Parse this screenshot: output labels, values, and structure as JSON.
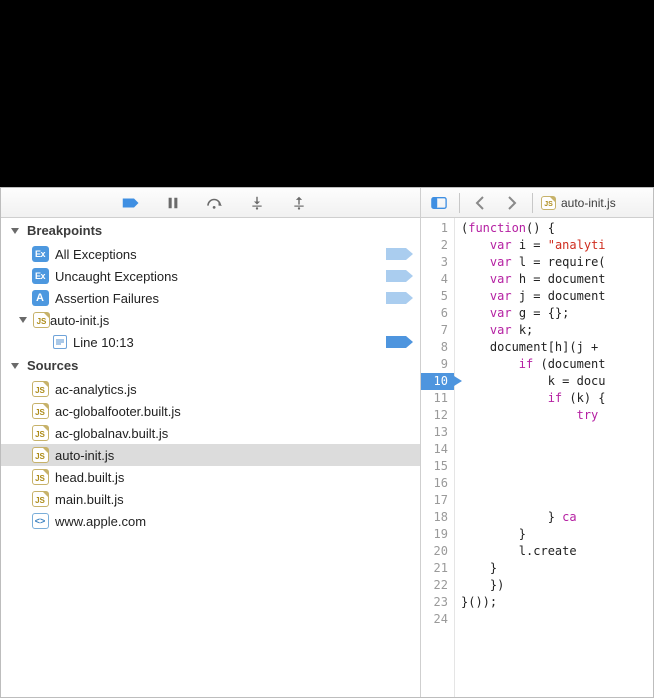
{
  "sidebar": {
    "breakpoints_header": "Breakpoints",
    "sources_header": "Sources",
    "breakpointItems": [
      {
        "icon": "ex",
        "label": "All Exceptions",
        "tag": "light"
      },
      {
        "icon": "ex",
        "label": "Uncaught Exceptions",
        "tag": "light"
      },
      {
        "icon": "a",
        "label": "Assertion Failures",
        "tag": "light"
      }
    ],
    "bpFile": {
      "name": "auto-init.js",
      "line_label": "Line 10:13"
    },
    "sources": [
      {
        "icon": "js",
        "label": "ac-analytics.js",
        "selected": false
      },
      {
        "icon": "js",
        "label": "ac-globalfooter.built.js",
        "selected": false
      },
      {
        "icon": "js",
        "label": "ac-globalnav.built.js",
        "selected": false
      },
      {
        "icon": "js",
        "label": "auto-init.js",
        "selected": true
      },
      {
        "icon": "js",
        "label": "head.built.js",
        "selected": false
      },
      {
        "icon": "js",
        "label": "main.built.js",
        "selected": false
      },
      {
        "icon": "html",
        "label": "www.apple.com",
        "selected": false
      }
    ]
  },
  "editor": {
    "filename": "auto-init.js",
    "highlightLine": 10,
    "lines": [
      {
        "n": 1,
        "indent": 0,
        "tokens": [
          {
            "t": "plain",
            "v": "("
          },
          {
            "t": "kw",
            "v": "function"
          },
          {
            "t": "plain",
            "v": "() {"
          }
        ]
      },
      {
        "n": 2,
        "indent": 1,
        "tokens": [
          {
            "t": "kw",
            "v": "var"
          },
          {
            "t": "plain",
            "v": " i = "
          },
          {
            "t": "str",
            "v": "\"analyti"
          }
        ]
      },
      {
        "n": 3,
        "indent": 1,
        "tokens": [
          {
            "t": "kw",
            "v": "var"
          },
          {
            "t": "plain",
            "v": " l = require("
          }
        ]
      },
      {
        "n": 4,
        "indent": 1,
        "tokens": [
          {
            "t": "kw",
            "v": "var"
          },
          {
            "t": "plain",
            "v": " h = document"
          }
        ]
      },
      {
        "n": 5,
        "indent": 1,
        "tokens": [
          {
            "t": "kw",
            "v": "var"
          },
          {
            "t": "plain",
            "v": " j = document"
          }
        ]
      },
      {
        "n": 6,
        "indent": 1,
        "tokens": [
          {
            "t": "kw",
            "v": "var"
          },
          {
            "t": "plain",
            "v": " g = {};"
          }
        ]
      },
      {
        "n": 7,
        "indent": 1,
        "tokens": [
          {
            "t": "kw",
            "v": "var"
          },
          {
            "t": "plain",
            "v": " k;"
          }
        ]
      },
      {
        "n": 8,
        "indent": 1,
        "tokens": [
          {
            "t": "plain",
            "v": "document[h](j + "
          }
        ]
      },
      {
        "n": 9,
        "indent": 2,
        "tokens": [
          {
            "t": "kw",
            "v": "if"
          },
          {
            "t": "plain",
            "v": " (document"
          }
        ]
      },
      {
        "n": 10,
        "indent": 3,
        "tokens": [
          {
            "t": "plain",
            "v": "k = docu"
          }
        ]
      },
      {
        "n": 11,
        "indent": 3,
        "tokens": [
          {
            "t": "kw",
            "v": "if"
          },
          {
            "t": "plain",
            "v": " (k) {"
          }
        ]
      },
      {
        "n": 12,
        "indent": 4,
        "tokens": [
          {
            "t": "kw",
            "v": "try"
          },
          {
            "t": "plain",
            "v": " "
          }
        ]
      },
      {
        "n": 13,
        "indent": 0,
        "tokens": []
      },
      {
        "n": 14,
        "indent": 0,
        "tokens": []
      },
      {
        "n": 15,
        "indent": 0,
        "tokens": []
      },
      {
        "n": 16,
        "indent": 0,
        "tokens": []
      },
      {
        "n": 17,
        "indent": 0,
        "tokens": []
      },
      {
        "n": 18,
        "indent": 3,
        "tokens": [
          {
            "t": "plain",
            "v": "} "
          },
          {
            "t": "kw",
            "v": "ca"
          }
        ]
      },
      {
        "n": 19,
        "indent": 2,
        "tokens": [
          {
            "t": "plain",
            "v": "}"
          }
        ]
      },
      {
        "n": 20,
        "indent": 2,
        "tokens": [
          {
            "t": "plain",
            "v": "l.create"
          }
        ]
      },
      {
        "n": 21,
        "indent": 1,
        "tokens": [
          {
            "t": "plain",
            "v": "}"
          }
        ]
      },
      {
        "n": 22,
        "indent": 1,
        "tokens": [
          {
            "t": "plain",
            "v": "})"
          }
        ]
      },
      {
        "n": 23,
        "indent": 0,
        "tokens": [
          {
            "t": "plain",
            "v": "}());"
          }
        ]
      },
      {
        "n": 24,
        "indent": 0,
        "tokens": []
      }
    ]
  },
  "icons": {
    "js_label": "JS",
    "html_label": "<>",
    "ex_label": "Ex",
    "a_label": "A"
  }
}
